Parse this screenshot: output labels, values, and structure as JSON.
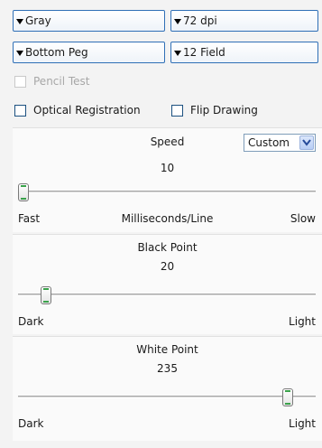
{
  "dropdowns": {
    "color": "Gray",
    "resolution": "72 dpi",
    "peg": "Bottom Peg",
    "field": "12 Field"
  },
  "checkboxes": {
    "pencil_test": {
      "label": "Pencil Test",
      "checked": false,
      "enabled": false
    },
    "optical_registration": {
      "label": "Optical Registration",
      "checked": false,
      "enabled": true
    },
    "flip_drawing": {
      "label": "Flip Drawing",
      "checked": false,
      "enabled": true
    }
  },
  "speed": {
    "title": "Speed",
    "value": "10",
    "mode": "Custom",
    "level": 0.0,
    "left_label": "Fast",
    "center_label": "Milliseconds/Line",
    "right_label": "Slow"
  },
  "black_point": {
    "title": "Black Point",
    "value": "20",
    "level": 0.08,
    "left_label": "Dark",
    "right_label": "Light"
  },
  "white_point": {
    "title": "White Point",
    "value": "235",
    "level": 0.92,
    "left_label": "Dark",
    "right_label": "Light"
  },
  "colors": {
    "dropdown_border": "#2f6fb6",
    "thumb_accent": "#3aa24b"
  },
  "icons": {
    "dropdown": "triangle-down-icon",
    "select": "chevron-down-icon"
  }
}
